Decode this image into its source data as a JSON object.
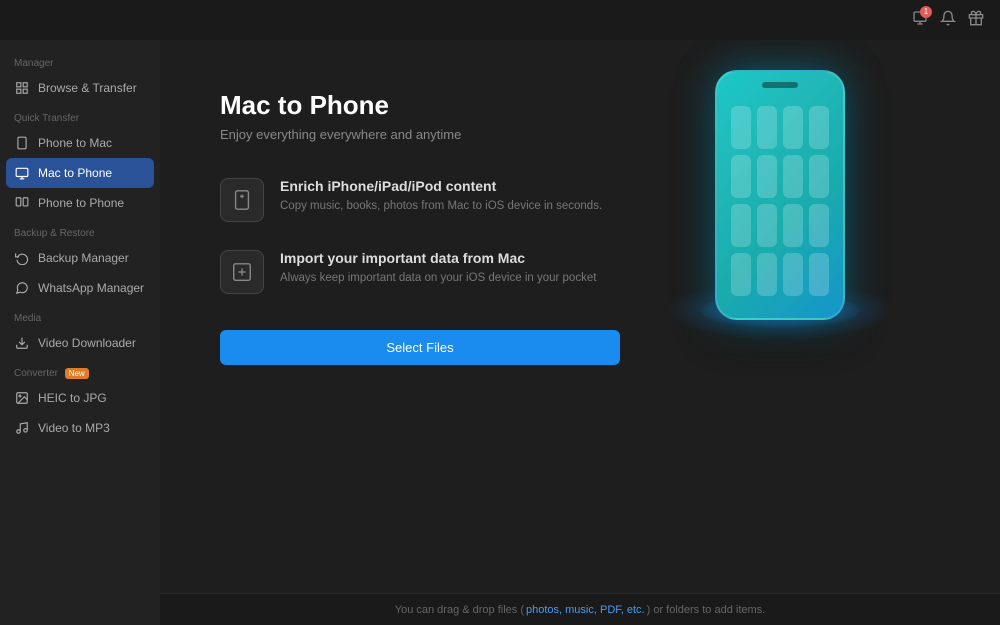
{
  "topbar": {
    "icons": [
      "notification-icon",
      "bell-icon",
      "gift-icon"
    ]
  },
  "sidebar": {
    "manager_label": "Manager",
    "manager_items": [
      {
        "id": "browse-transfer",
        "label": "Browse & Transfer",
        "icon": "⊞"
      }
    ],
    "quick_transfer_label": "Quick Transfer",
    "quick_transfer_items": [
      {
        "id": "phone-to-mac",
        "label": "Phone to Mac",
        "icon": "📱",
        "active": false
      },
      {
        "id": "mac-to-phone",
        "label": "Mac to Phone",
        "icon": "💻",
        "active": true
      },
      {
        "id": "phone-to-phone",
        "label": "Phone to Phone",
        "icon": "📲",
        "active": false
      }
    ],
    "backup_label": "Backup & Restore",
    "backup_items": [
      {
        "id": "backup-manager",
        "label": "Backup Manager",
        "icon": "🗄"
      },
      {
        "id": "whatsapp-manager",
        "label": "WhatsApp Manager",
        "icon": "💬"
      }
    ],
    "media_label": "Media",
    "media_items": [
      {
        "id": "video-downloader",
        "label": "Video Downloader",
        "icon": "⬇"
      }
    ],
    "converter_label": "Converter",
    "converter_badge": "New",
    "converter_items": [
      {
        "id": "heic-to-jpg",
        "label": "HEIC to JPG",
        "icon": "🖼"
      },
      {
        "id": "video-to-mp3",
        "label": "Video to MP3",
        "icon": "🎵"
      }
    ]
  },
  "content": {
    "title": "Mac to Phone",
    "subtitle": "Enjoy everything everywhere and anytime",
    "feature1_title": "Enrich iPhone/iPad/iPod content",
    "feature1_desc": "Copy music, books, photos from Mac to iOS device in seconds.",
    "feature2_title": "Import your important data from Mac",
    "feature2_desc": "Always keep important data on your iOS device in your pocket",
    "select_files_btn": "Select Files"
  },
  "statusbar": {
    "text_prefix": "You can drag & drop files (",
    "link_text": "photos, music, PDF, etc.",
    "text_suffix": ") or folders to add items."
  }
}
